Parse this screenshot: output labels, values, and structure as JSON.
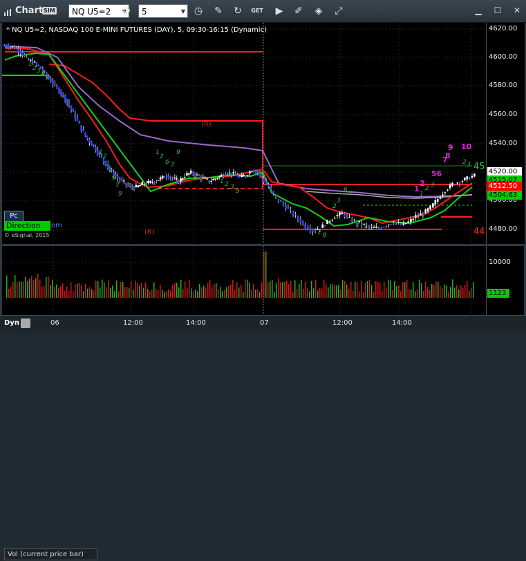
{
  "titlebar": {
    "app_title": "Chart",
    "sim_badge": "SIM",
    "symbol_value": "NQ U5=2",
    "interval_value": "5",
    "buttons": [
      "gear-icon",
      "clock-icon",
      "pencil-icon",
      "refresh-icon",
      "get-icon",
      "play-icon",
      "edit-icon",
      "tag-icon",
      "minimize-icon",
      "maximize-icon",
      "close-icon"
    ],
    "get_label": "GET"
  },
  "chart": {
    "title": "* NQ U5=2, NASDAQ 100 E-MINI FUTURES (DAY), 5, 09:30-16:15 (Dynamic)",
    "pc_label": "Pc",
    "direction_label": "Direction",
    "direction_ext": "om",
    "copyright": "© eSignal, 2015",
    "marker_r1": "(R)",
    "marker_r2": "(R)",
    "side_45": "45",
    "side_44": "44",
    "count_labels": [
      "1",
      "2",
      "56",
      "7",
      "8",
      "9",
      "10"
    ],
    "price_tags": [
      {
        "text": "4520.00",
        "bg": "#ffffff",
        "fg": "#000000"
      },
      {
        "text": "4515.07",
        "bg": "#00cc00",
        "fg": "#000000"
      },
      {
        "text": "4512.50",
        "bg": "#ff0000",
        "fg": "#ffffff"
      },
      {
        "text": "4504.63",
        "bg": "#00cc00",
        "fg": "#000000"
      }
    ]
  },
  "price_axis": {
    "ticks": [
      "4620.00",
      "4600.00",
      "4580.00",
      "4560.00",
      "4540.00",
      "4520.00",
      "4500.00",
      "4480.00"
    ]
  },
  "volume": {
    "label": "Vol (current price bar)",
    "tick": "10000",
    "current_tag": "1123"
  },
  "timebar": {
    "dyn_label": "Dyn",
    "times": [
      "06",
      "12:00",
      "14:00",
      "07",
      "12:00",
      "14:00"
    ]
  },
  "chart_data": {
    "type": "candlestick",
    "title": "* NQ U5=2, NASDAQ 100 E-MINI FUTURES (DAY), 5, 09:30-16:15 (Dynamic)",
    "ylim": [
      4473,
      4625
    ],
    "yticks": [
      4620,
      4600,
      4580,
      4560,
      4540,
      4520,
      4500,
      4480
    ],
    "xticks": [
      "06",
      "12:00",
      "14:00",
      "07",
      "12:00",
      "14:00"
    ],
    "close_path": [
      4609,
      4608,
      4605,
      4600,
      4598,
      4595,
      4590,
      4585,
      4580,
      4575,
      4568,
      4560,
      4552,
      4545,
      4540,
      4534,
      4528,
      4522,
      4518,
      4515,
      4512,
      4512,
      4514,
      4515,
      4516,
      4518,
      4520,
      4518,
      4516,
      4520,
      4522,
      4520,
      4518,
      4516,
      4518,
      4520,
      4522,
      4521,
      4519,
      4520,
      4524,
      4522,
      4518,
      4512,
      4504,
      4500,
      4495,
      4490,
      4485,
      4482,
      4484,
      4488,
      4492,
      4494,
      4490,
      4488,
      4486,
      4484,
      4484,
      4486,
      4488,
      4486,
      4488,
      4492,
      4494,
      4498,
      4504,
      4510,
      4514,
      4516,
      4518,
      4520
    ],
    "key_levels": [
      {
        "name": "upper red line day 1",
        "price": 4604
      },
      {
        "name": "green line day 1",
        "price": 4587
      },
      {
        "name": "(R) line",
        "price": 4555
      },
      {
        "name": "green level day 2",
        "price": 4524
      },
      {
        "name": "red level day 2",
        "price": 4481
      }
    ],
    "volume_tick": 10000,
    "volume_last": 1123
  }
}
